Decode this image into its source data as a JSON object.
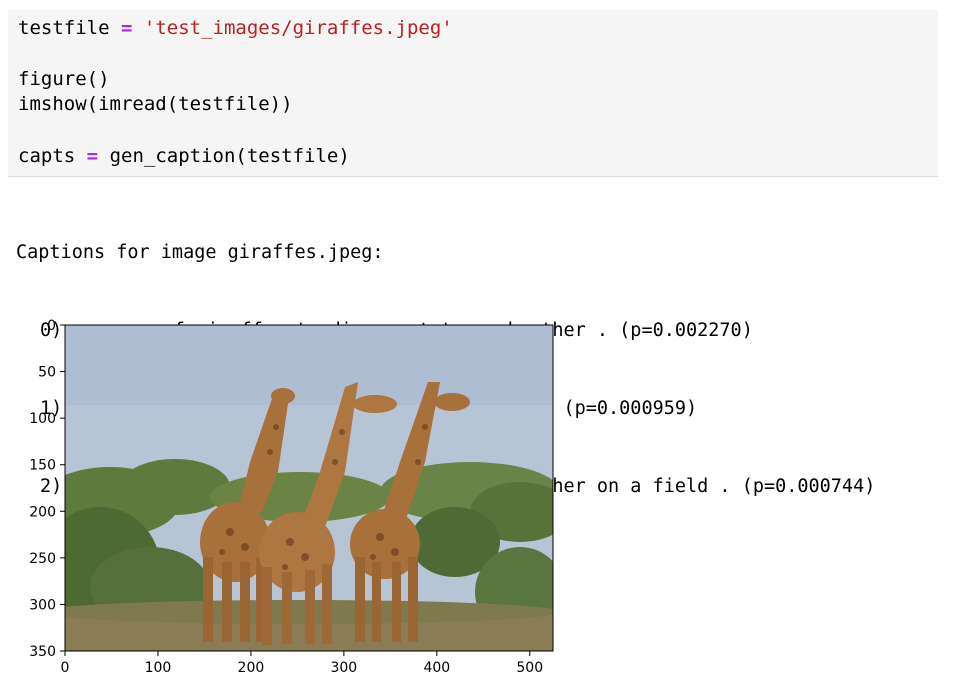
{
  "code": {
    "line1": {
      "var": "testfile",
      "op": "=",
      "str": "'test_images/giraffes.jpeg'"
    },
    "line2": "figure()",
    "line3": "imshow(imread(testfile))",
    "line4": {
      "var": "capts",
      "op": "=",
      "rest": "gen_caption(testfile)"
    }
  },
  "output": {
    "header": "Captions for image giraffes.jpeg:",
    "captions": [
      "0) a group of giraffe standing next to each other . (p=0.002270)",
      "1) a group of giraffes are standing in a field (p=0.000959)",
      "2) a group of giraffe standing next to each other on a field . (p=0.000744)"
    ]
  },
  "chart_data": {
    "type": "image",
    "x_ticks": [
      "0",
      "100",
      "200",
      "300",
      "400",
      "500"
    ],
    "y_ticks": [
      "0",
      "50",
      "100",
      "150",
      "200",
      "250",
      "300",
      "350"
    ],
    "xlim": [
      0,
      525
    ],
    "ylim": [
      350,
      0
    ]
  },
  "colors": {
    "cell_bg": "#f5f5f5",
    "keyword_op": "#aa22ff",
    "string": "#ba2121",
    "sky": "#b7c4d6",
    "bush": "#5f7a3d",
    "grass": "#8a7d55",
    "giraffe": "#a8703a",
    "giraffe_spot": "#5c3416"
  }
}
